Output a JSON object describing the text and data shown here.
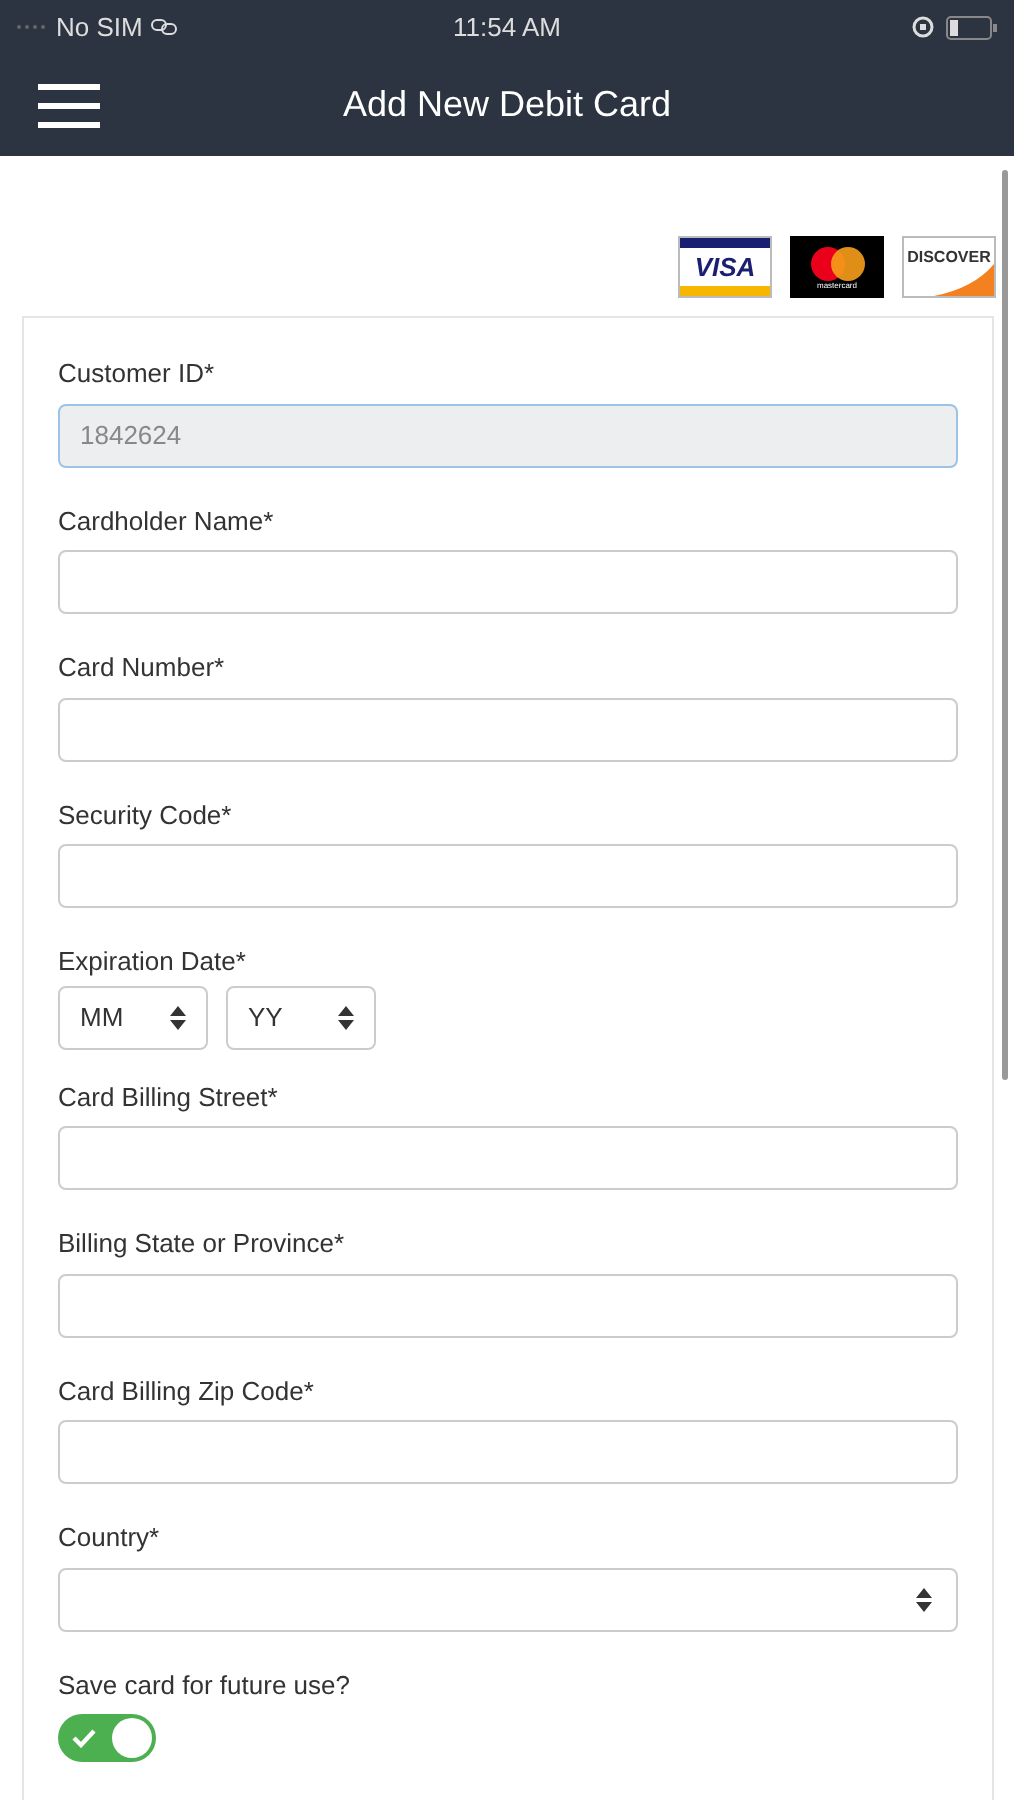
{
  "status_bar": {
    "carrier": "No SIM",
    "time": "11:54 AM"
  },
  "nav": {
    "title": "Add New Debit Card"
  },
  "card_logos": [
    {
      "kind": "visa",
      "label": "VISA"
    },
    {
      "kind": "mastercard",
      "label": "mastercard"
    },
    {
      "kind": "discover",
      "label": "DISCOVER"
    }
  ],
  "fields": [
    {
      "kind": "text",
      "label": "Customer ID*",
      "value": "1842624",
      "disabled": true
    },
    {
      "kind": "text",
      "label": "Cardholder Name*",
      "disabled": false
    },
    {
      "kind": "text",
      "label": "Card Number*",
      "disabled": false
    },
    {
      "kind": "text",
      "label": "Security Code*",
      "disabled": false
    },
    {
      "kind": "expiry",
      "label": "Expiration Date*",
      "month": "MM",
      "year": "YY"
    },
    {
      "kind": "text",
      "label": "Card Billing Street*",
      "disabled": false
    },
    {
      "kind": "text",
      "label": "Billing State or Province*",
      "disabled": false
    },
    {
      "kind": "text",
      "label": "Card Billing Zip Code*",
      "disabled": false
    },
    {
      "kind": "select",
      "label": "Country*"
    },
    {
      "kind": "toggle",
      "label": "Save card for future use?",
      "on": true
    }
  ]
}
